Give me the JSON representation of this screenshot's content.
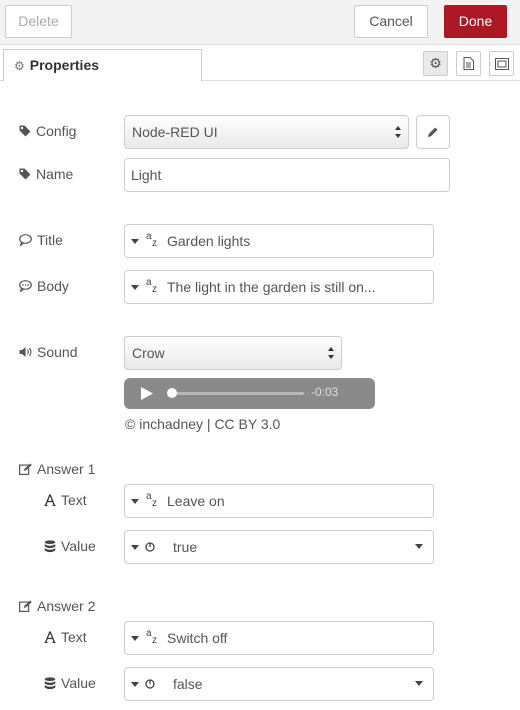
{
  "toolbar": {
    "delete_label": "Delete",
    "cancel_label": "Cancel",
    "done_label": "Done",
    "done_color": "#ad1625"
  },
  "tabs": {
    "properties_label": "Properties",
    "icon_tabs": [
      "gear-icon",
      "document-icon",
      "frame-icon"
    ]
  },
  "config": {
    "label": "Config",
    "value": "Node-RED UI"
  },
  "name": {
    "label": "Name",
    "value": "Light"
  },
  "title": {
    "label": "Title",
    "value": "Garden lights"
  },
  "body": {
    "label": "Body",
    "value": "The light in the garden is still on..."
  },
  "sound": {
    "label": "Sound",
    "value": "Crow",
    "player_time": "-0:03",
    "credit": "© inchadney | CC BY 3.0"
  },
  "answer1": {
    "label": "Answer 1",
    "text_label": "Text",
    "text_value": "Leave on",
    "value_label": "Value",
    "value_value": "true"
  },
  "answer2": {
    "label": "Answer 2",
    "text_label": "Text",
    "text_value": "Switch off",
    "value_label": "Value",
    "value_value": "false"
  }
}
